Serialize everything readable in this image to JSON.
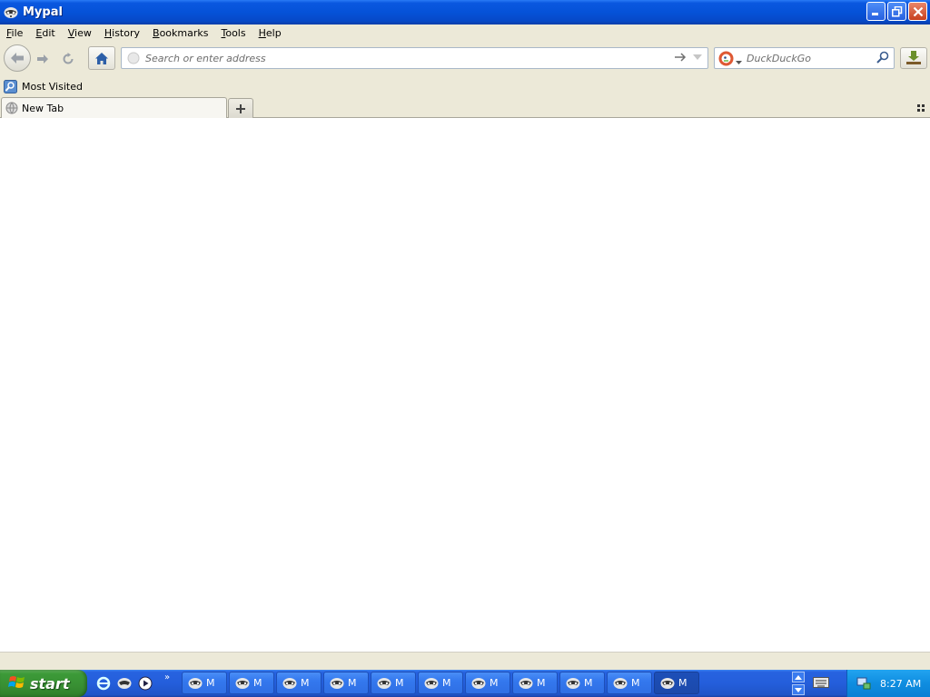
{
  "window": {
    "title": "Mypal"
  },
  "menu": {
    "items": [
      {
        "access": "F",
        "rest": "ile"
      },
      {
        "access": "E",
        "rest": "dit"
      },
      {
        "access": "V",
        "rest": "iew"
      },
      {
        "access": "H",
        "rest": "istory"
      },
      {
        "access": "B",
        "rest": "ookmarks"
      },
      {
        "access": "T",
        "rest": "ools"
      },
      {
        "access": "H",
        "rest": "elp"
      }
    ]
  },
  "navbar": {
    "address_placeholder": "Search or enter address",
    "search_placeholder": "DuckDuckGo"
  },
  "bookmarks": {
    "most_visited": "Most Visited"
  },
  "tabs": {
    "active_label": "New Tab"
  },
  "taskbar": {
    "start_label": "start",
    "task_label": "M",
    "task_count": 11,
    "active_task_index": 10,
    "clock": "8:27 AM"
  },
  "colors": {
    "titlebar": "#0552d8",
    "chrome": "#ece9d8",
    "taskbar": "#245edb",
    "start_green": "#388f33",
    "tray": "#0f8de0"
  }
}
